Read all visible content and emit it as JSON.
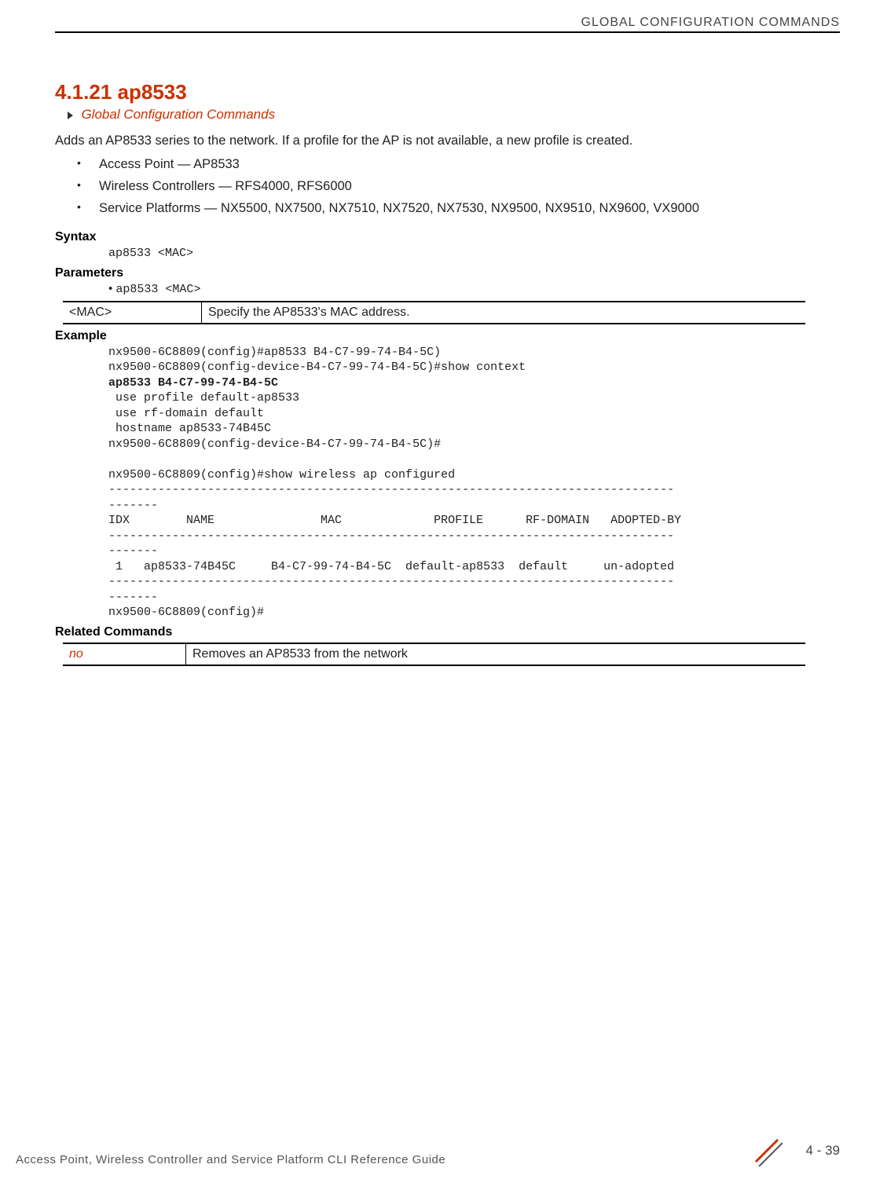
{
  "header": {
    "category": "GLOBAL CONFIGURATION COMMANDS"
  },
  "section": {
    "number_title": "4.1.21 ap8533",
    "breadcrumb": "Global Configuration Commands",
    "intro": "Adds an AP8533 series to the network. If a profile for the AP is not available, a new profile is created.",
    "bullets": [
      "Access Point — AP8533",
      "Wireless Controllers — RFS4000, RFS6000",
      "Service Platforms — NX5500, NX7500, NX7510, NX7520, NX7530, NX9500, NX9510, NX9600, VX9000"
    ]
  },
  "syntax": {
    "label": "Syntax",
    "code": "ap8533 <MAC>"
  },
  "parameters": {
    "label": "Parameters",
    "bullet": "ap8533 <MAC>",
    "table": {
      "col1": "<MAC>",
      "col2": "Specify the AP8533's MAC address."
    }
  },
  "example": {
    "label": "Example",
    "line1": "nx9500-6C8809(config)#ap8533 B4-C7-99-74-B4-5C)",
    "line2": "nx9500-6C8809(config-device-B4-C7-99-74-B4-5C)#show context",
    "line3_bold": "ap8533 B4-C7-99-74-B4-5C",
    "line4": " use profile default-ap8533",
    "line5": " use rf-domain default",
    "line6": " hostname ap8533-74B45C",
    "line7": "nx9500-6C8809(config-device-B4-C7-99-74-B4-5C)#",
    "line8": "",
    "line9": "nx9500-6C8809(config)#show wireless ap configured",
    "dash80": "--------------------------------------------------------------------------------",
    "dash7": "-------",
    "header_row": "IDX        NAME               MAC             PROFILE      RF-DOMAIN   ADOPTED-BY",
    "data_row": " 1   ap8533-74B45C     B4-C7-99-74-B4-5C  default-ap8533  default     un-adopted",
    "prompt": "nx9500-6C8809(config)#"
  },
  "related": {
    "label": "Related Commands",
    "table": {
      "col1": "no",
      "col2": "Removes an AP8533 from the network"
    }
  },
  "footer": {
    "left": "Access Point, Wireless Controller and Service Platform CLI Reference Guide",
    "page": "4 - 39"
  }
}
